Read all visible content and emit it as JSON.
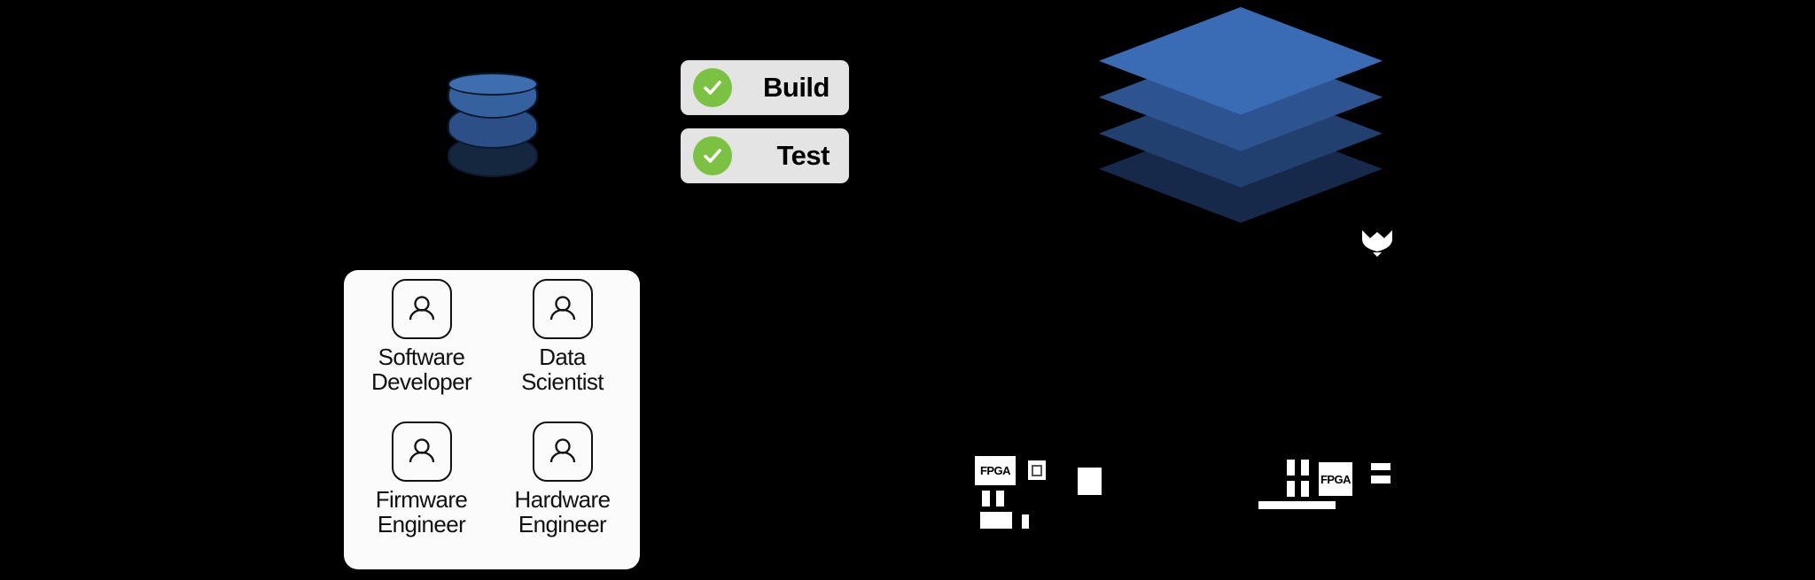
{
  "diagram": {
    "title": "Development workflow and hardware platform diagram",
    "background_color": "#000000"
  },
  "database": {
    "name": "database-cylinder",
    "band_colors": [
      "#3f6eb0",
      "#36619f",
      "#2b4f86",
      "#15263f"
    ],
    "outline_color": "#0c1a30"
  },
  "status_badges": {
    "accent_green": "#7cc242",
    "background": "#e4e4e4",
    "items": [
      {
        "id": "build",
        "label": "Build",
        "icon": "check-circle-icon",
        "state": "passed"
      },
      {
        "id": "test",
        "label": "Test",
        "icon": "check-circle-icon",
        "state": "passed"
      }
    ]
  },
  "personas": {
    "card_background": "#fbfbfb",
    "items": [
      {
        "icon": "person-icon",
        "line1": "Software",
        "line2": "Developer"
      },
      {
        "icon": "person-icon",
        "line1": "Data",
        "line2": "Scientist"
      },
      {
        "icon": "person-icon",
        "line1": "Firmware",
        "line2": "Engineer"
      },
      {
        "icon": "person-icon",
        "line1": "Hardware",
        "line2": "Engineer"
      }
    ]
  },
  "layer_stack": {
    "name": "isometric-layer-stack",
    "layer_count": 4,
    "colors": [
      "#3a6bb5",
      "#2d5490",
      "#22406f",
      "#17294a"
    ],
    "gap_color": "#ffffff",
    "marker_icon": "chevron-down-icon",
    "marker_color": "#ffffff"
  },
  "hardware": {
    "clusters": [
      {
        "id": "fpga-board-left",
        "chip_label": "FPGA",
        "parts": [
          "fpga-chip",
          "connector-outline",
          "pin-pair",
          "port-block",
          "pin-single",
          "module-block"
        ]
      },
      {
        "id": "fpga-board-right",
        "chip_label": "FPGA",
        "parts": [
          "pin-grid",
          "fpga-chip",
          "bar-top",
          "bar-bottom",
          "edge-connector"
        ]
      }
    ]
  }
}
